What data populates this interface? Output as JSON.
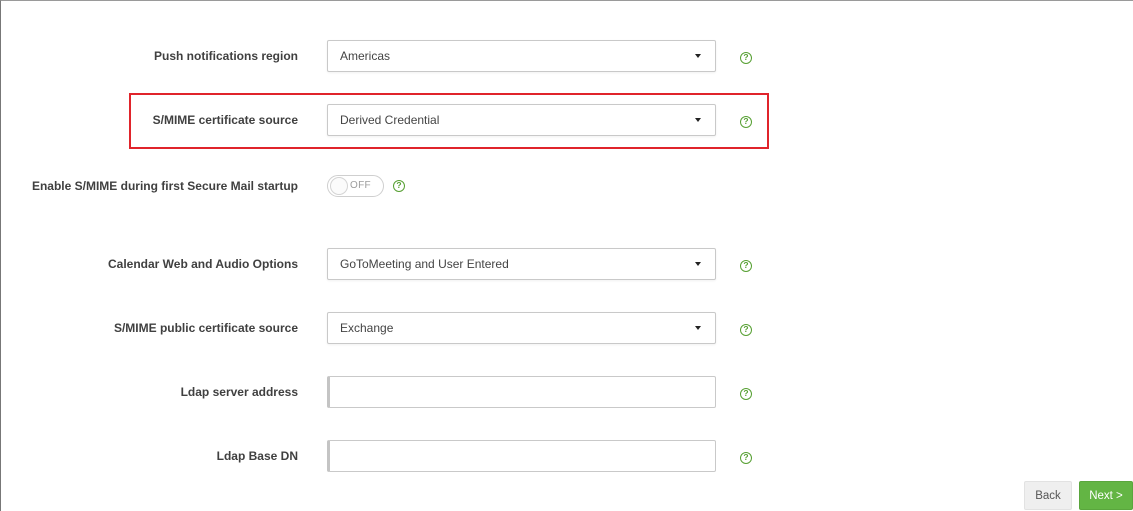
{
  "form": {
    "push_region": {
      "label": "Push notifications region",
      "value": "Americas",
      "help_icon": "help-circle-icon"
    },
    "smime_cert_source": {
      "label": "S/MIME certificate source",
      "value": "Derived Credential",
      "help_icon": "help-circle-icon",
      "highlighted": true,
      "highlight_color": "#e0242b"
    },
    "enable_smime": {
      "label": "Enable S/MIME during first Secure Mail startup",
      "toggle_text": "OFF",
      "state": false,
      "help_icon": "help-circle-icon"
    },
    "calendar_options": {
      "label": "Calendar Web and Audio Options",
      "value": "GoToMeeting and User Entered",
      "help_icon": "help-circle-icon"
    },
    "smime_public_cert_source": {
      "label": "S/MIME public certificate source",
      "value": "Exchange",
      "help_icon": "help-circle-icon"
    },
    "ldap_server": {
      "label": "Ldap server address",
      "value": "",
      "placeholder": "",
      "help_icon": "help-circle-icon"
    },
    "ldap_base_dn": {
      "label": "Ldap Base DN",
      "value": "",
      "placeholder": "",
      "help_icon": "help-circle-icon"
    },
    "help_glyph": "?"
  },
  "footer": {
    "back_label": "Back",
    "next_label": "Next >"
  },
  "colors": {
    "accent_green": "#63b544",
    "help_green": "#57a033"
  }
}
